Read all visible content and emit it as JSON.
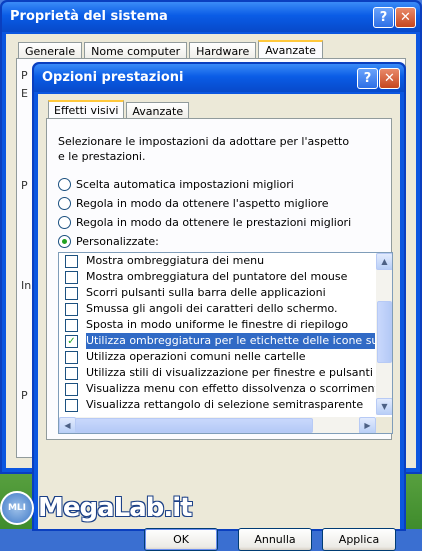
{
  "outer_window": {
    "title": "Proprietà del sistema",
    "help_glyph": "?",
    "close_glyph": "✕",
    "tabs": [
      {
        "label": "Generale",
        "active": false
      },
      {
        "label": "Nome computer",
        "active": false
      },
      {
        "label": "Hardware",
        "active": false
      },
      {
        "label": "Avanzate",
        "active": true
      }
    ],
    "ghost_chars": [
      "P",
      "E",
      "P",
      "In",
      "P"
    ]
  },
  "dialog": {
    "title": "Opzioni prestazioni",
    "help_glyph": "?",
    "close_glyph": "✕",
    "tabs": [
      {
        "label": "Effetti visivi",
        "active": true
      },
      {
        "label": "Avanzate",
        "active": false
      }
    ],
    "description": "Selezionare le impostazioni da adottare per l'aspetto e le prestazioni.",
    "radio_options": [
      {
        "label": "Scelta automatica impostazioni migliori",
        "selected": false
      },
      {
        "label": "Regola in modo da ottenere l'aspetto migliore",
        "selected": false
      },
      {
        "label": "Regola in modo da ottenere le prestazioni migliori",
        "selected": false
      },
      {
        "label": "Personalizzate:",
        "selected": true
      }
    ],
    "effects": [
      {
        "label": "Mostra ombreggiatura dei menu",
        "checked": false,
        "selected": false
      },
      {
        "label": "Mostra ombreggiatura del puntatore del mouse",
        "checked": false,
        "selected": false
      },
      {
        "label": "Scorri pulsanti sulla barra delle applicazioni",
        "checked": false,
        "selected": false
      },
      {
        "label": "Smussa gli angoli dei caratteri dello schermo.",
        "checked": false,
        "selected": false
      },
      {
        "label": "Sposta in modo uniforme le finestre di riepilogo",
        "checked": false,
        "selected": false
      },
      {
        "label": "Utilizza ombreggiatura per le etichette delle icone sul desk",
        "checked": true,
        "selected": true
      },
      {
        "label": "Utilizza operazioni comuni nelle cartelle",
        "checked": false,
        "selected": false
      },
      {
        "label": "Utilizza stili di visualizzazione per finestre e pulsanti",
        "checked": false,
        "selected": false
      },
      {
        "label": "Visualizza menu con effetto dissolvenza o scorrimento",
        "checked": false,
        "selected": false
      },
      {
        "label": "Visualizza rettangolo di selezione semitrasparente",
        "checked": false,
        "selected": false
      }
    ],
    "scroll_up_glyph": "▲",
    "scroll_down_glyph": "▼",
    "scroll_left_glyph": "◀",
    "scroll_right_glyph": "▶",
    "check_glyph": "✓",
    "buttons": {
      "ok": "OK",
      "cancel": "Annulla",
      "apply": "Applica"
    }
  },
  "watermark": {
    "badge": "MLI",
    "text": "MegaLab.it"
  },
  "colors": {
    "titlebar": "#0a5ce6",
    "selection": "#316ac5",
    "checkmark": "#21a121",
    "tab_accent": "#ffc83c"
  }
}
